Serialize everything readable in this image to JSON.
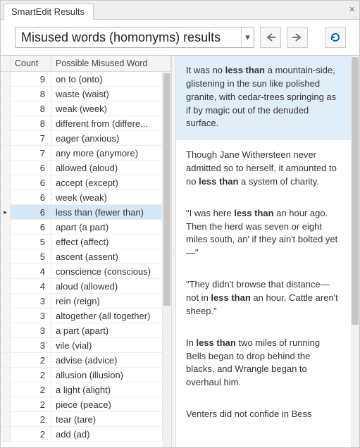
{
  "window": {
    "tab_title": "SmartEdit Results",
    "close_glyph": "×"
  },
  "toolbar": {
    "dropdown_text": "Misused words (homonyms) results",
    "dropdown_caret": "▾"
  },
  "grid": {
    "headers": {
      "count": "Count",
      "word": "Possible Misused Word"
    },
    "selected_index": 9,
    "rows": [
      {
        "count": 9,
        "word": "on to (onto)"
      },
      {
        "count": 8,
        "word": "waste (waist)"
      },
      {
        "count": 8,
        "word": "weak (week)"
      },
      {
        "count": 8,
        "word": "different from (differe..."
      },
      {
        "count": 7,
        "word": "eager (anxious)"
      },
      {
        "count": 7,
        "word": "any more (anymore)"
      },
      {
        "count": 6,
        "word": "allowed (aloud)"
      },
      {
        "count": 6,
        "word": "accept (except)"
      },
      {
        "count": 6,
        "word": "week (weak)"
      },
      {
        "count": 6,
        "word": "less than (fewer than)"
      },
      {
        "count": 6,
        "word": "apart (a part)"
      },
      {
        "count": 5,
        "word": "effect (affect)"
      },
      {
        "count": 5,
        "word": "ascent (assent)"
      },
      {
        "count": 4,
        "word": "conscience (conscious)"
      },
      {
        "count": 4,
        "word": "aloud (allowed)"
      },
      {
        "count": 3,
        "word": "rein (reign)"
      },
      {
        "count": 3,
        "word": "altogether (all together)"
      },
      {
        "count": 3,
        "word": "a part (apart)"
      },
      {
        "count": 3,
        "word": "vile (vial)"
      },
      {
        "count": 2,
        "word": "advise (advice)"
      },
      {
        "count": 2,
        "word": "allusion (illusion)"
      },
      {
        "count": 2,
        "word": "a light (alight)"
      },
      {
        "count": 2,
        "word": "piece (peace)"
      },
      {
        "count": 2,
        "word": "tear (tare)"
      },
      {
        "count": 2,
        "word": "add (ad)"
      }
    ],
    "row_indicator": "▸"
  },
  "snippets": {
    "highlight": "less than",
    "selected_index": 0,
    "items": [
      {
        "pre": "It was no ",
        "post": " a mountain-side, glistening in the sun like polished granite, with cedar-trees springing as if by magic out of the denuded surface."
      },
      {
        "pre": "Though Jane Withersteen never admitted so to herself, it amounted to no ",
        "post": " a system of charity."
      },
      {
        "pre": "\"I was here ",
        "post": " an hour ago. Then the herd was seven or eight miles south, an' if they ain't bolted yet—\""
      },
      {
        "pre": "\"They didn't browse that distance—not in ",
        "post": " an hour. Cattle aren't sheep.\""
      },
      {
        "pre": "In ",
        "post": " two miles of running Bells began to drop behind the blacks, and Wrangle began to overhaul him."
      },
      {
        "pre": "Venters did not confide in Bess",
        "post": ""
      }
    ]
  }
}
